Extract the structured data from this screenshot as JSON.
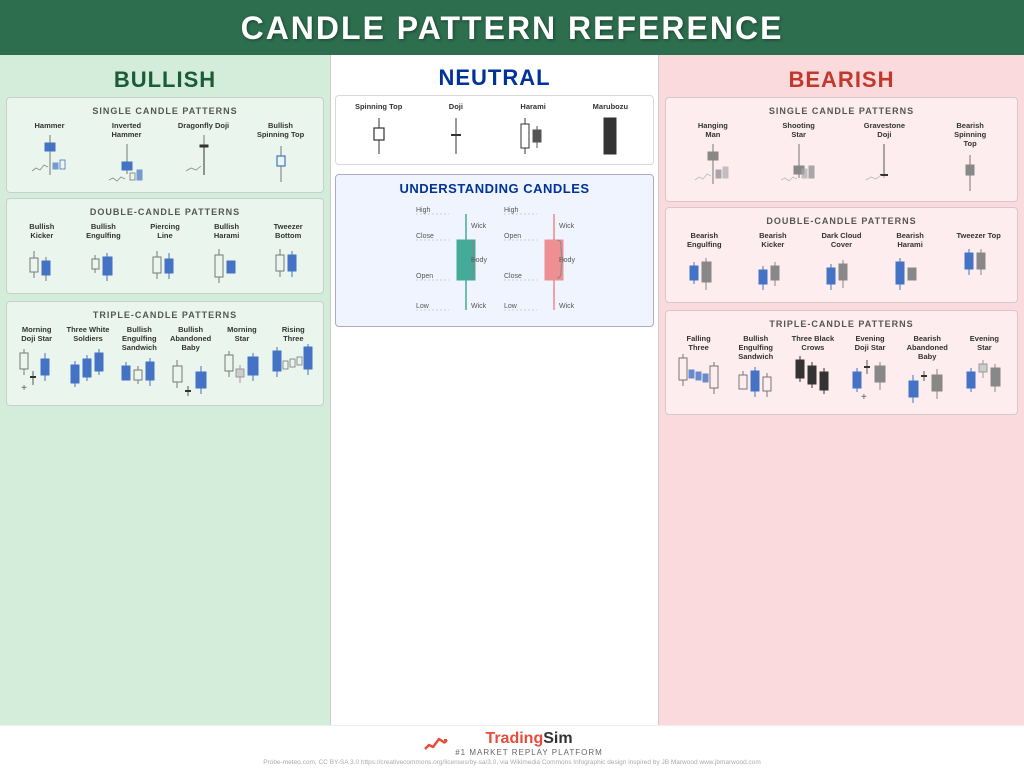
{
  "header": {
    "title": "CANDLE PATTERN REFERENCE"
  },
  "columns": {
    "bullish": {
      "label": "BULLISH",
      "single_label": "SINGLE CANDLE PATTERNS",
      "double_label": "DOUBLE-CANDLE PATTERNS",
      "triple_label": "TRIPLE-CANDLE PATTERNS",
      "single_patterns": [
        "Hammer",
        "Inverted Hammer",
        "Dragonfly Doji",
        "Bullish Spinning Top"
      ],
      "double_patterns": [
        "Bullish Kicker",
        "Bullish Engulfing",
        "Piercing Line",
        "Bullish Harami",
        "Tweezer Bottom"
      ],
      "triple_patterns": [
        "Morning Doji Star",
        "Three White Soldiers",
        "Bullish Engulfing Sandwich",
        "Bullish Abandoned Baby",
        "Morning Star",
        "Rising Three"
      ]
    },
    "neutral": {
      "label": "NEUTRAL",
      "understanding_title": "UNDERSTANDING CANDLES",
      "patterns": [
        "Spinning Top",
        "Doji",
        "Harami",
        "Marubozu"
      ]
    },
    "bearish": {
      "label": "BEARISH",
      "single_label": "SINGLE CANDLE PATTERNS",
      "double_label": "DOUBLE-CANDLE PATTERNS",
      "triple_label": "TRIPLE-CANDLE PATTERNS",
      "single_patterns": [
        "Hanging Man",
        "Shooting Star",
        "Gravestone Doji",
        "Bearish Spinning Top"
      ],
      "double_patterns": [
        "Bearish Engulfing",
        "Bearish Kicker",
        "Dark Cloud Cover",
        "Bearish Harami",
        "Tweezer Top"
      ],
      "triple_patterns": [
        "Falling Three",
        "Bullish Engulfing Sandwich",
        "Three Black Crows",
        "Evening Doji Star",
        "Bearish Abandoned Baby",
        "Evening Star"
      ]
    }
  },
  "footer": {
    "brand": "TradingSim",
    "tagline": "#1 MARKET REPLAY PLATFORM",
    "credits": "Probe-meteo.com, CC BY-SA 3.0 https://creativecommons.org/licenses/by-sa/3.0, via Wikimedia Commons     Infographic design inspired by JB Marwood www.jbmarwood.com"
  }
}
